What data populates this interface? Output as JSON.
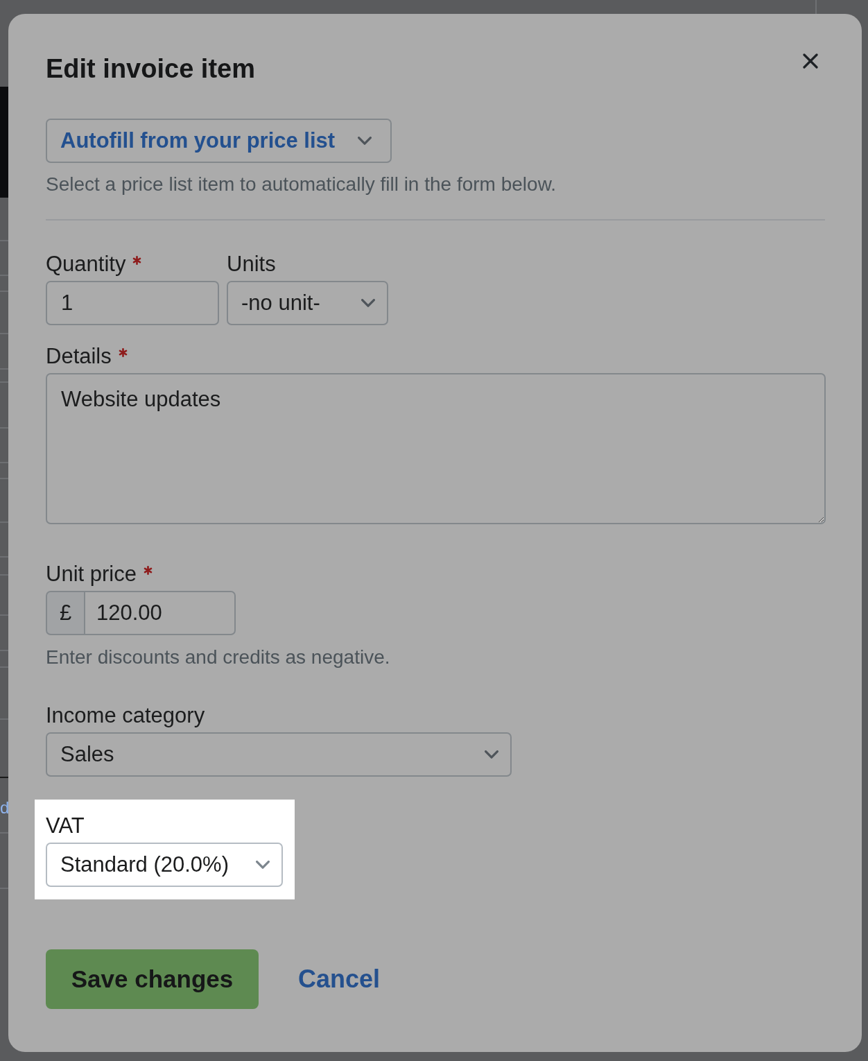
{
  "backdrop": {
    "link_fragment": "d"
  },
  "dialog": {
    "title": "Edit invoice item",
    "autofill": {
      "label": "Autofill from your price list",
      "help": "Select a price list item to automatically fill in the form below."
    },
    "rows": [
      [
        {
          "kind": "input",
          "label": "Quantity",
          "required": true,
          "value": "1",
          "highlighted": false
        },
        {
          "kind": "select",
          "label": "Units",
          "required": false,
          "value": "-no unit-",
          "highlighted": false
        }
      ],
      [
        {
          "kind": "textarea",
          "label": "Details",
          "required": true,
          "value": "Website updates",
          "highlighted": false
        }
      ],
      [
        {
          "kind": "currency",
          "label": "Unit price",
          "required": true,
          "prefix": "£",
          "value": "120.00",
          "help": "Enter discounts and credits as negative.",
          "highlighted": false
        }
      ],
      [
        {
          "kind": "select",
          "label": "Income category",
          "required": false,
          "value": "Sales",
          "highlighted": false
        }
      ],
      [
        {
          "kind": "select",
          "label": "VAT",
          "required": false,
          "value": "Standard (20.0%)",
          "highlighted": true
        }
      ]
    ],
    "buttons": [
      {
        "kind": "primary",
        "label": "Save changes"
      },
      {
        "kind": "link",
        "label": "Cancel"
      }
    ]
  }
}
